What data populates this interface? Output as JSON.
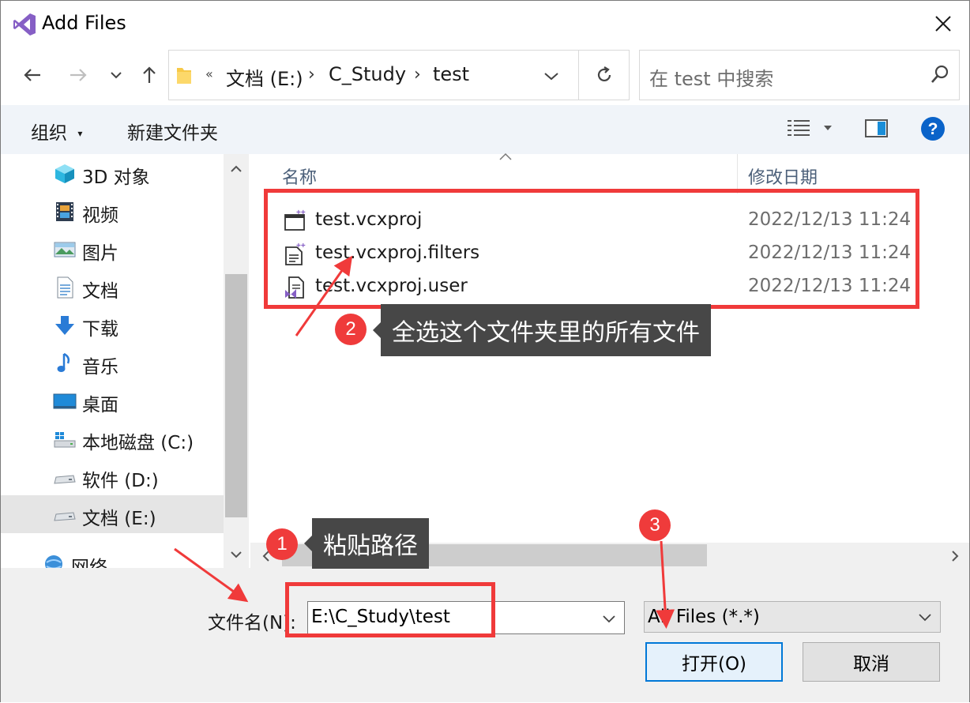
{
  "window": {
    "title": "Add Files"
  },
  "address": {
    "crumbs": [
      "文档 (E:)",
      "C_Study",
      "test"
    ],
    "overflow_chevron": "«"
  },
  "search": {
    "placeholder": "在 test 中搜索"
  },
  "toolbar": {
    "organize": "组织",
    "new_folder": "新建文件夹"
  },
  "nav": {
    "items": [
      {
        "label": "3D 对象",
        "icon": "cube-3d-icon"
      },
      {
        "label": "视频",
        "icon": "video-icon"
      },
      {
        "label": "图片",
        "icon": "pictures-icon"
      },
      {
        "label": "文档",
        "icon": "document-icon"
      },
      {
        "label": "下载",
        "icon": "download-icon"
      },
      {
        "label": "音乐",
        "icon": "music-icon"
      },
      {
        "label": "桌面",
        "icon": "desktop-icon"
      },
      {
        "label": "本地磁盘 (C:)",
        "icon": "system-drive-icon"
      },
      {
        "label": "软件 (D:)",
        "icon": "drive-icon"
      },
      {
        "label": "文档 (E:)",
        "icon": "drive-icon",
        "selected": true
      },
      {
        "label": "网络",
        "icon": "network-icon"
      }
    ]
  },
  "files": {
    "columns": {
      "name": "名称",
      "modified": "修改日期"
    },
    "rows": [
      {
        "name": "test.vcxproj",
        "date": "2022/12/13 11:24",
        "icon": "vcxproj-icon"
      },
      {
        "name": "test.vcxproj.filters",
        "date": "2022/12/13 11:24",
        "icon": "filters-file-icon"
      },
      {
        "name": "test.vcxproj.user",
        "date": "2022/12/13 11:24",
        "icon": "vs-user-file-icon"
      }
    ]
  },
  "bottom": {
    "filename_label": "文件名(N):",
    "filename_value": "E:\\C_Study\\test",
    "filetype_value": "All Files (*.*)",
    "open_label": "打开(O)",
    "cancel_label": "取消"
  },
  "annotations": {
    "step1": {
      "number": "1",
      "text": "粘贴路径"
    },
    "step2": {
      "number": "2",
      "text": "全选这个文件夹里的所有文件"
    },
    "step3": {
      "number": "3"
    }
  },
  "colors": {
    "accent": "#0078d7",
    "annotation_red": "#f03a3a",
    "tooltip_bg": "#474747"
  }
}
